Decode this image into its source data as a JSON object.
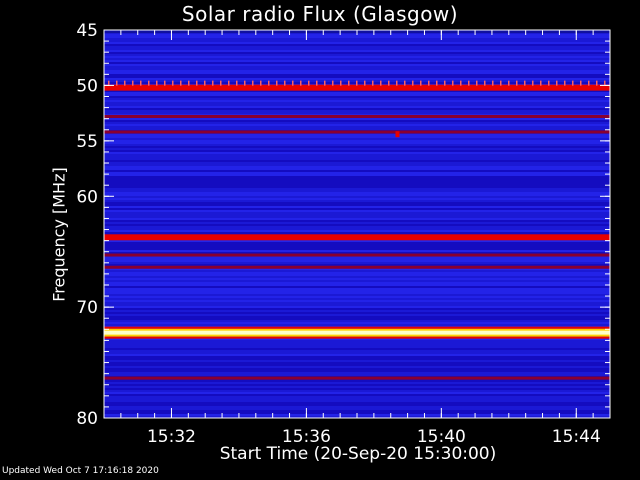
{
  "chart_data": {
    "type": "heatmap",
    "title": "Solar radio Flux (Glasgow)",
    "xlabel": "Start Time (20-Sep-20 15:30:00)",
    "ylabel": "Frequency [MHz]",
    "x_range_minutes": [
      "15:30",
      "15:45"
    ],
    "xlim": [
      0,
      15
    ],
    "ylim": [
      45,
      80
    ],
    "x_ticks": [
      {
        "label": "15:32",
        "value": 2
      },
      {
        "label": "15:36",
        "value": 6
      },
      {
        "label": "15:40",
        "value": 10
      },
      {
        "label": "15:44",
        "value": 14
      }
    ],
    "y_ticks": [
      {
        "label": "45",
        "value": 45
      },
      {
        "label": "50",
        "value": 50
      },
      {
        "label": "55",
        "value": 55
      },
      {
        "label": "60",
        "value": 60
      },
      {
        "label": "70",
        "value": 70
      },
      {
        "label": "80",
        "value": 80
      }
    ],
    "background_level": "blue",
    "bands": [
      {
        "freq_mhz": 50.2,
        "intensity": "red"
      },
      {
        "freq_mhz": 52.8,
        "intensity": "dark-red"
      },
      {
        "freq_mhz": 54.2,
        "intensity": "dark-red"
      },
      {
        "freq_mhz": 63.7,
        "intensity": "red"
      },
      {
        "freq_mhz": 65.3,
        "intensity": "dark-red"
      },
      {
        "freq_mhz": 66.4,
        "intensity": "dark-red"
      },
      {
        "freq_mhz": 72.3,
        "intensity": "white-hot"
      },
      {
        "freq_mhz": 76.4,
        "intensity": "dark-red"
      }
    ],
    "burst": {
      "time_min": 8.7,
      "freq_mhz": 54.4,
      "intensity": "red"
    },
    "colors": {
      "background": "#000000",
      "plot_low": "#1e1ee0",
      "plot_mid": "#1208b8",
      "band_red": "#e80000",
      "band_dark": "#8a0030",
      "band_hot": "#ffffc8",
      "band_hot_edge": "#ffd000",
      "axis": "#ffffff"
    }
  },
  "footer": {
    "updated": "Updated Wed Oct  7 17:16:18 2020"
  }
}
